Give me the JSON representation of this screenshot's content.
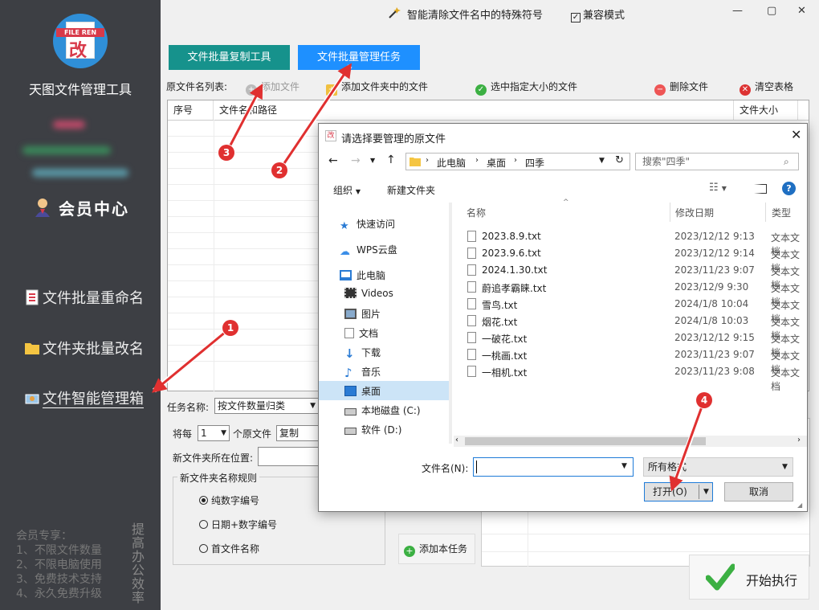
{
  "sidebar": {
    "logo_text": "FILE REN",
    "logo_glyph": "改",
    "app_name": "天图文件管理工具",
    "member_center": "会员中心",
    "items": [
      {
        "label": "文件批量重命名",
        "icon": "document-list-icon"
      },
      {
        "label": "文件夹批量改名",
        "icon": "folder-icon"
      },
      {
        "label": "文件智能管理箱",
        "icon": "toolbox-icon"
      }
    ],
    "promo_lines": [
      "会员专享：",
      "1、不限文件数量",
      "2、不限电脑使用",
      "3、免费技术支持",
      "4、永久免费升级"
    ],
    "promo_vertical": "提高办公效率"
  },
  "titlebar": {
    "clean_tool": "智能清除文件名中的特殊符号",
    "compat_mode": "兼容模式"
  },
  "tabs": {
    "copy_tool": "文件批量复制工具",
    "manage_task": "文件批量管理任务"
  },
  "toolbar": {
    "list_label": "原文件名列表:",
    "add_file": "添加文件",
    "add_folder": "添加文件夹中的文件",
    "select_size": "选中指定大小的文件",
    "delete_file": "删除文件",
    "clear_table": "清空表格"
  },
  "table": {
    "col_index": "序号",
    "col_path": "文件名和路径",
    "col_size": "文件大小"
  },
  "task": {
    "name_label": "任务名称:",
    "name_value": "按文件数量归类",
    "per_label": "将每",
    "per_value": "1",
    "per_suffix": "个原文件",
    "op_value": "复制",
    "location_label": "新文件夹所在位置:",
    "rule_group": "新文件夹名称规则",
    "rule_options": [
      "纯数字编号",
      "日期+数字编号",
      "首文件名称"
    ],
    "add_task": "添加本任务",
    "start": "开始执行"
  },
  "dialog": {
    "title": "请选择要管理的原文件",
    "breadcrumb": [
      "此电脑",
      "桌面",
      "四季"
    ],
    "search_placeholder": "搜索\"四季\"",
    "organize": "组织",
    "new_folder": "新建文件夹",
    "nav": [
      "快速访问",
      "WPS云盘",
      "此电脑",
      "Videos",
      "图片",
      "文档",
      "下载",
      "音乐",
      "桌面",
      "本地磁盘 (C:)",
      "软件 (D:)"
    ],
    "columns": {
      "name": "名称",
      "date": "修改日期",
      "type": "类型"
    },
    "files": [
      {
        "name": "2023.8.9.txt",
        "date": "2023/12/12 9:13",
        "type": "文本文档"
      },
      {
        "name": "2023.9.6.txt",
        "date": "2023/12/12 9:14",
        "type": "文本文档"
      },
      {
        "name": "2024.1.30.txt",
        "date": "2023/11/23 9:07",
        "type": "文本文档"
      },
      {
        "name": "蔚追孝霸睐.txt",
        "date": "2023/12/9 9:30",
        "type": "文本文档"
      },
      {
        "name": "雪鸟.txt",
        "date": "2024/1/8 10:04",
        "type": "文本文档"
      },
      {
        "name": "烟花.txt",
        "date": "2024/1/8 10:03",
        "type": "文本文档"
      },
      {
        "name": "一破花.txt",
        "date": "2023/12/12 9:15",
        "type": "文本文档"
      },
      {
        "name": "一桃画.txt",
        "date": "2023/11/23 9:07",
        "type": "文本文档"
      },
      {
        "name": "一相机.txt",
        "date": "2023/11/23 9:08",
        "type": "文本文档"
      }
    ],
    "filename_label": "文件名(N):",
    "filter_value": "所有格式",
    "open_button": "打开(O)",
    "cancel_button": "取消"
  },
  "annotations": [
    "1",
    "2",
    "3",
    "4"
  ],
  "colors": {
    "sidebar_bg": "#3d3f44",
    "teal_tab": "#16928c",
    "blue_tab": "#1e90ff",
    "annotation_red": "#e03030"
  }
}
